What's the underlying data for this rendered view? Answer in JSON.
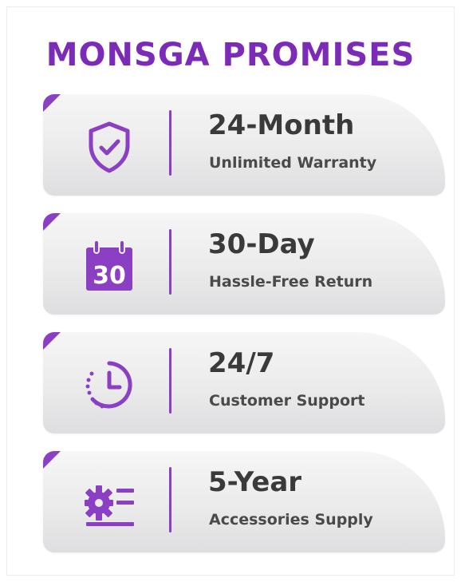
{
  "title": "MONSGA PROMISES",
  "colors": {
    "accent": "#7b2bb8",
    "icon": "#8a3fc4",
    "text": "#3a3a3a"
  },
  "promises": [
    {
      "icon": "shield-check-icon",
      "main": "24-Month",
      "sub": "Unlimited Warranty"
    },
    {
      "icon": "calendar-icon",
      "calendar_number": "30",
      "main": "30-Day",
      "sub": "Hassle-Free Return"
    },
    {
      "icon": "clock-icon",
      "main": "24/7",
      "sub": "Customer Support"
    },
    {
      "icon": "gear-list-icon",
      "main": "5-Year",
      "sub": "Accessories Supply"
    }
  ]
}
